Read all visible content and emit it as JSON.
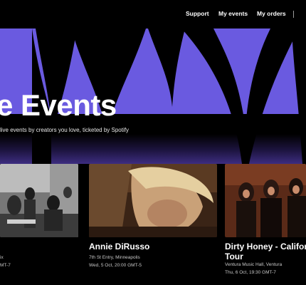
{
  "nav": {
    "support": "Support",
    "my_events": "My events",
    "my_orders": "My orders"
  },
  "hero": {
    "title": "e Events",
    "subtitle": "live events by creators you love, ticketed by Spotify"
  },
  "events": [
    {
      "name": "",
      "venue": "ix",
      "date": "MT-7"
    },
    {
      "name": "Annie DiRusso",
      "venue": "7th St Entry, Minneapolis",
      "date": "Wed, 5 Oct, 20:00 GMT-5"
    },
    {
      "name_line1": "Dirty Honey - California",
      "name_line2": "Tour",
      "venue": "Ventura Music Hall, Ventura",
      "date": "Thu, 6 Oct, 19:30 GMT-7"
    }
  ],
  "colors": {
    "accent": "#6a5ae0",
    "background": "#000000"
  }
}
